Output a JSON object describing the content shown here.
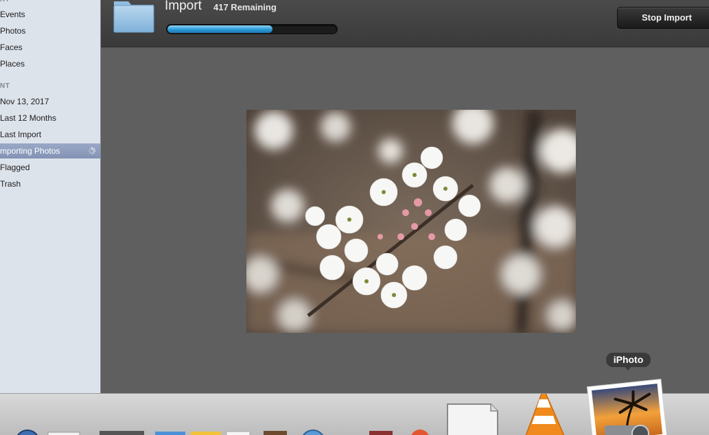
{
  "sidebar": {
    "library_header": "RY",
    "library_items": [
      {
        "label": "Events"
      },
      {
        "label": "Photos"
      },
      {
        "label": "Faces"
      },
      {
        "label": "Places"
      }
    ],
    "recent_header": "NT",
    "recent_items": [
      {
        "label": "Nov 13, 2017"
      },
      {
        "label": "Last 12 Months"
      },
      {
        "label": "Last Import"
      },
      {
        "label": "mporting Photos"
      },
      {
        "label": "Flagged"
      },
      {
        "label": "Trash"
      }
    ]
  },
  "import": {
    "title": "Import",
    "remaining": "417 Remaining",
    "progress": 0.62,
    "stop_label": "Stop Import"
  },
  "dock": {
    "tooltip": "iPhoto"
  },
  "colors": {
    "accent": "#2a9ad6",
    "selected_row": "#8e9cbd"
  }
}
